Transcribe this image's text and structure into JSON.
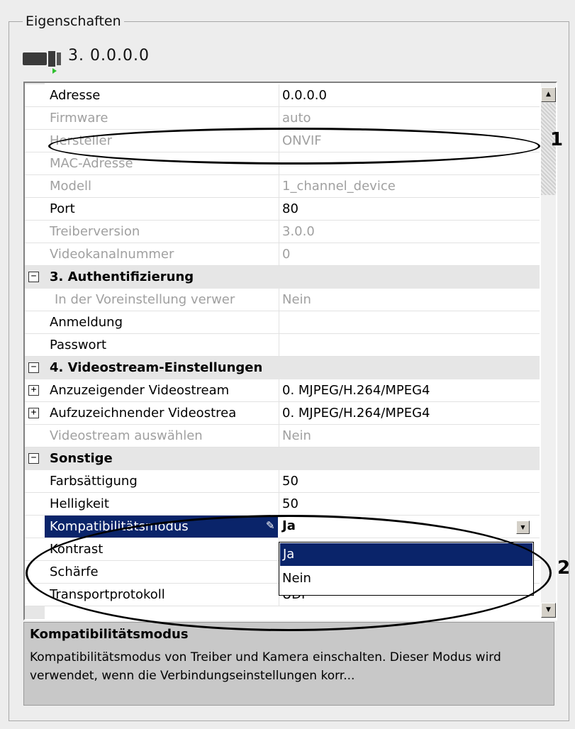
{
  "panel": {
    "title": "Eigenschaften",
    "device_title": "3. 0.0.0.0"
  },
  "rows": [
    {
      "name": "Adresse",
      "value": "0.0.0.0"
    },
    {
      "name": "Firmware",
      "value": "auto"
    },
    {
      "name": "Hersteller",
      "value": "ONVIF"
    },
    {
      "name": "MAC-Adresse",
      "value": ""
    },
    {
      "name": "Modell",
      "value": "1_channel_device"
    },
    {
      "name": "Port",
      "value": "80"
    },
    {
      "name": "Treiberversion",
      "value": "3.0.0"
    },
    {
      "name": "Videokanalnummer",
      "value": "0"
    },
    {
      "name": "3. Authentifizierung"
    },
    {
      "name": "In der Voreinstellung verwer",
      "value": "Nein"
    },
    {
      "name": "Anmeldung",
      "value": ""
    },
    {
      "name": "Passwort",
      "value": ""
    },
    {
      "name": "4. Videostream-Einstellungen"
    },
    {
      "name": "Anzuzeigender Videostream",
      "value": "0. MJPEG/H.264/MPEG4"
    },
    {
      "name": "Aufzuzeichnender Videostrea",
      "value": "0. MJPEG/H.264/MPEG4"
    },
    {
      "name": "Videostream auswählen",
      "value": "Nein"
    },
    {
      "name": "Sonstige"
    },
    {
      "name": "Farbsättigung",
      "value": "50"
    },
    {
      "name": "Helligkeit",
      "value": "50"
    },
    {
      "name": "Kompatibilitätsmodus",
      "value": "Ja"
    },
    {
      "name": "Kontrast",
      "value": ""
    },
    {
      "name": "Schärfe",
      "value": ""
    },
    {
      "name": "Transportprotokoll",
      "value": "UDP"
    }
  ],
  "toggles": {
    "expanded": "−",
    "collapsed": "+"
  },
  "dropdown": {
    "options": [
      "Ja",
      "Nein"
    ],
    "selected": "Ja"
  },
  "annotations": {
    "one": "1",
    "two": "2"
  },
  "description": {
    "title": "Kompatibilitätsmodus",
    "text": "Kompatibilitätsmodus von Treiber und Kamera einschalten. Dieser Modus wird verwendet, wenn die Verbindungseinstellungen korr..."
  },
  "colors": {
    "selection": "#0a246a",
    "category_bg": "#e6e6e6",
    "disabled_text": "#a0a0a0"
  }
}
